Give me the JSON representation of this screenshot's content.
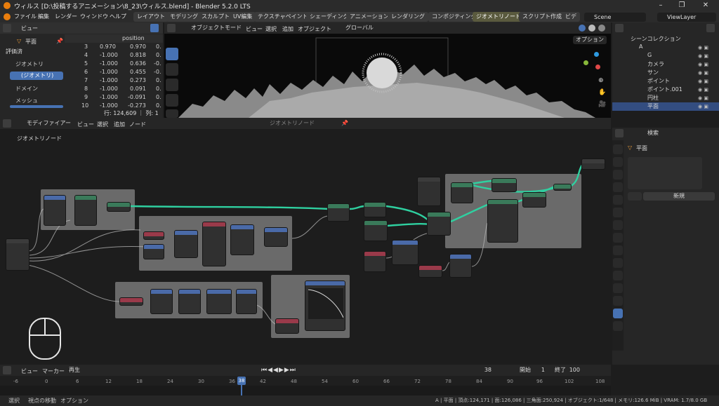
{
  "window": {
    "title": "ウィルス [D:\\投稿するアニメーション\\8_23\\ウィルス.blend] - Blender 5.2.0 LTS"
  },
  "menu": [
    "ファイル",
    "編集",
    "レンダー",
    "ウィンドウ",
    "ヘルプ"
  ],
  "workspaces": [
    "レイアウト",
    "モデリング",
    "スカルプト",
    "UV編集",
    "テクスチャペイント",
    "シェーディング",
    "アニメーション",
    "レンダリング",
    "コンポジティング",
    "ジオメトリノード",
    "スクリプト作成",
    "ビデ"
  ],
  "active_workspace": "ジオメトリノード",
  "scene": {
    "name": "Scene",
    "view_layer": "ViewLayer"
  },
  "spreadsheet": {
    "header_label": "ビュー",
    "object": "平面",
    "eval_mode": "評価済",
    "tree": [
      {
        "label": "ジオメトリ"
      },
      {
        "label": "(ジオメトリ)"
      },
      {
        "label": "ドメイン"
      },
      {
        "label": "メッシュ"
      }
    ],
    "column": "position",
    "rows": [
      {
        "i": "3",
        "a": "0.970",
        "b": "0.970",
        "c": "0."
      },
      {
        "i": "4",
        "a": "-1.000",
        "b": "0.818",
        "c": "0."
      },
      {
        "i": "5",
        "a": "-1.000",
        "b": "0.636",
        "c": "-0."
      },
      {
        "i": "6",
        "a": "-1.000",
        "b": "0.455",
        "c": "-0."
      },
      {
        "i": "7",
        "a": "-1.000",
        "b": "0.273",
        "c": "0."
      },
      {
        "i": "8",
        "a": "-1.000",
        "b": "0.091",
        "c": "0."
      },
      {
        "i": "9",
        "a": "-1.000",
        "b": "-0.091",
        "c": "0."
      },
      {
        "i": "10",
        "a": "-1.000",
        "b": "-0.273",
        "c": "0."
      }
    ],
    "footer": "行: 124,609 ｜ 列: 1"
  },
  "viewport": {
    "mode": "オブジェクトモード",
    "menus": [
      "ビュー",
      "選択",
      "追加",
      "オブジェクト"
    ],
    "transform": "グローバル",
    "options": "オプション"
  },
  "node_editor": {
    "editor_type": "モディファイアー",
    "menus": [
      "ビュー",
      "選択",
      "追加",
      "ノード"
    ],
    "tree_name": "ジオメトリノード",
    "breadcrumb": "ジオメトリノード"
  },
  "outliner": {
    "search_placeholder": "",
    "root": "シーンコレクション",
    "items": [
      {
        "label": "A"
      },
      {
        "label": "G"
      },
      {
        "label": "カメラ"
      },
      {
        "label": "サン"
      },
      {
        "label": "ポイント"
      },
      {
        "label": "ポイント.001"
      },
      {
        "label": "円柱"
      },
      {
        "label": "平面"
      }
    ]
  },
  "properties": {
    "search_placeholder": "検索",
    "object": "平面",
    "new_button": "新規"
  },
  "timeline": {
    "menus": [
      "ビュー",
      "マーカー",
      "再生"
    ],
    "current_frame": "38",
    "start_label": "開始",
    "start": "1",
    "end_label": "終了",
    "end": "100",
    "ticks": [
      "-6",
      "0",
      "6",
      "12",
      "18",
      "24",
      "30",
      "36",
      "42",
      "48",
      "54",
      "60",
      "66",
      "72",
      "78",
      "84",
      "90",
      "96",
      "102",
      "108"
    ]
  },
  "status": {
    "left": [
      "選択",
      "視点の移動",
      "オプション"
    ],
    "right": "A | 平面 | 頂点:124,171 | 面:126,086 | 三角面:250,924 | オブジェクト:1/648 | メモリ:126.6 MiB | VRAM: 1.7/8.0 GB"
  },
  "colors": {
    "accent": "#4772b3",
    "node_link_green": "#32c89a",
    "frame_gray": "#6a6a6a"
  }
}
